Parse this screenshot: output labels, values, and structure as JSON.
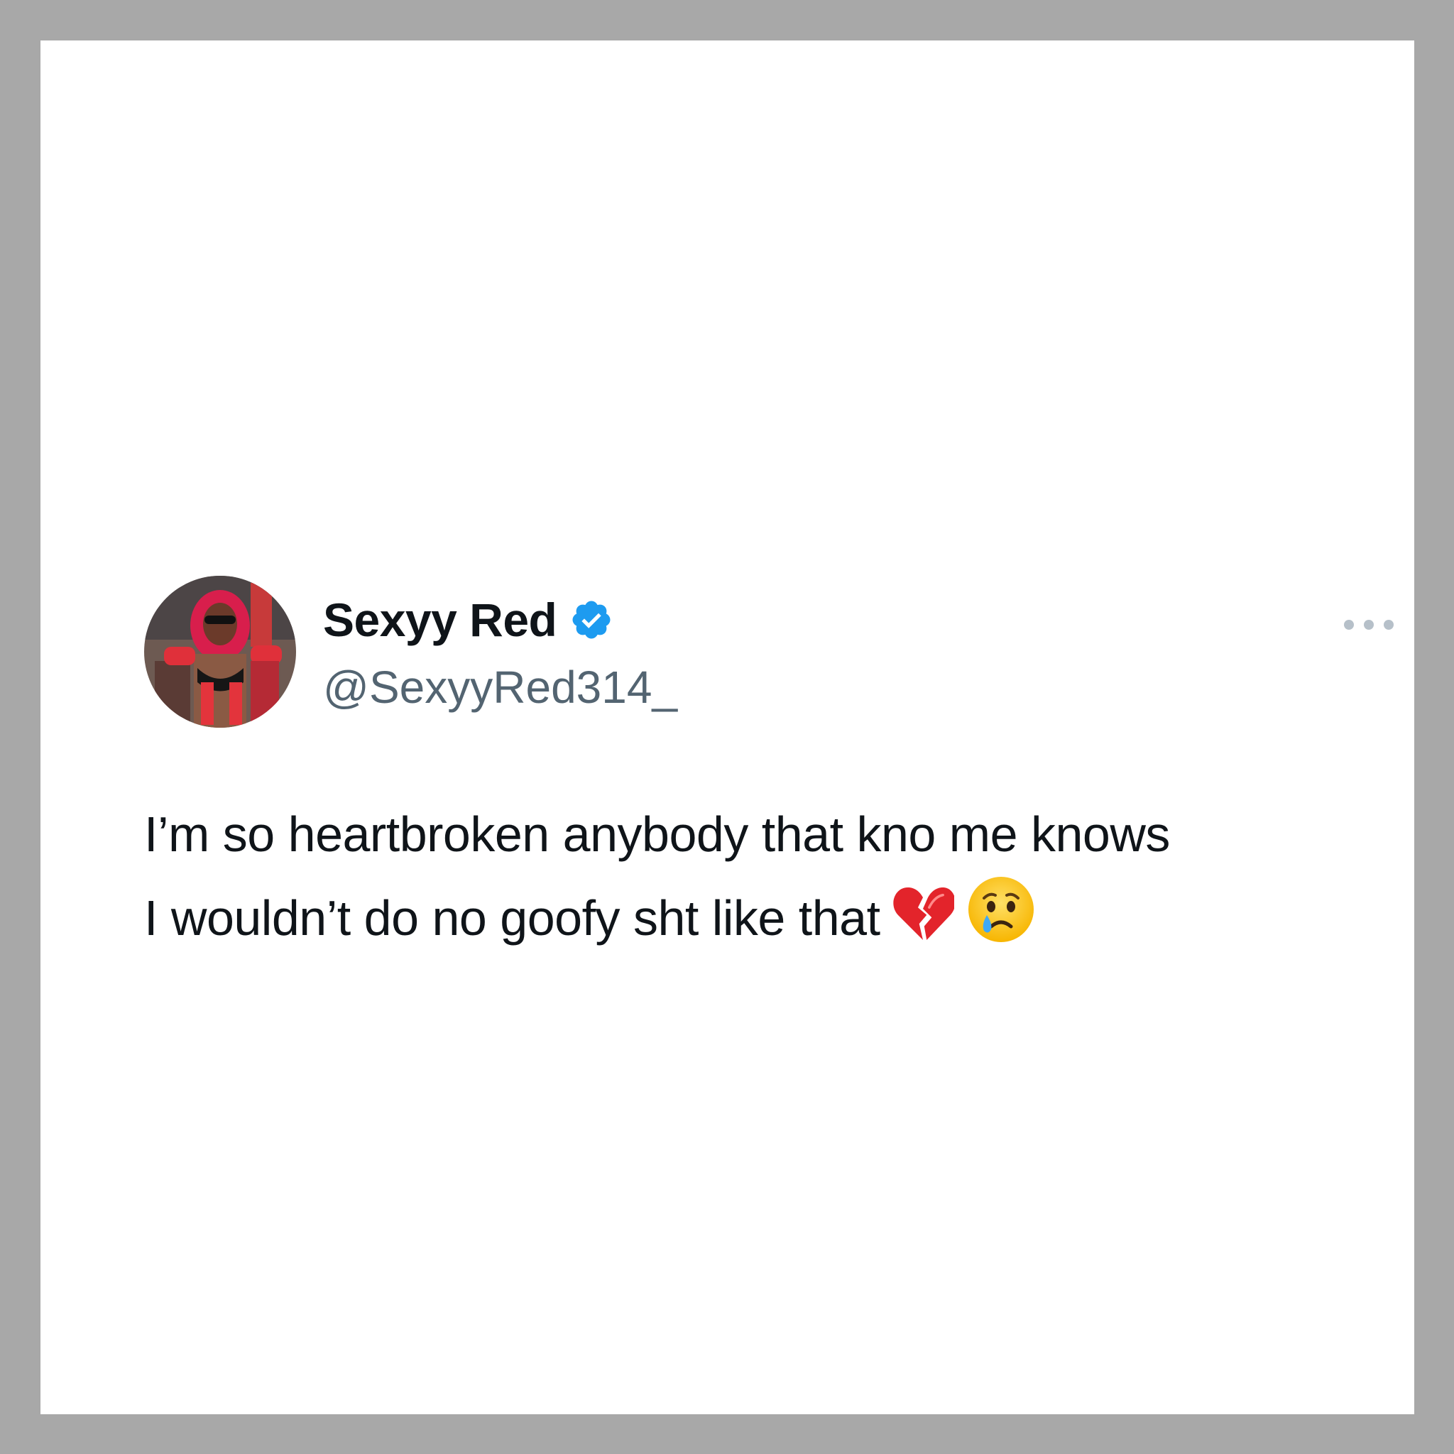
{
  "tweet": {
    "author": {
      "display_name": "Sexyy Red",
      "handle": "@SexyyRed314_",
      "verified": true,
      "avatar_icon": "profile-photo"
    },
    "more_icon": "more-options-icon",
    "text_lines": [
      "I’m so heartbroken anybody that kno me knows",
      "I wouldn’t do no goofy sht like that"
    ],
    "emojis": [
      "broken-heart-icon",
      "crying-face-icon"
    ]
  },
  "colors": {
    "frame": "#a8a8a8",
    "background": "#ffffff",
    "text": "#0f1419",
    "secondary_text": "#536471",
    "verified_blue": "#1d9bf0"
  }
}
